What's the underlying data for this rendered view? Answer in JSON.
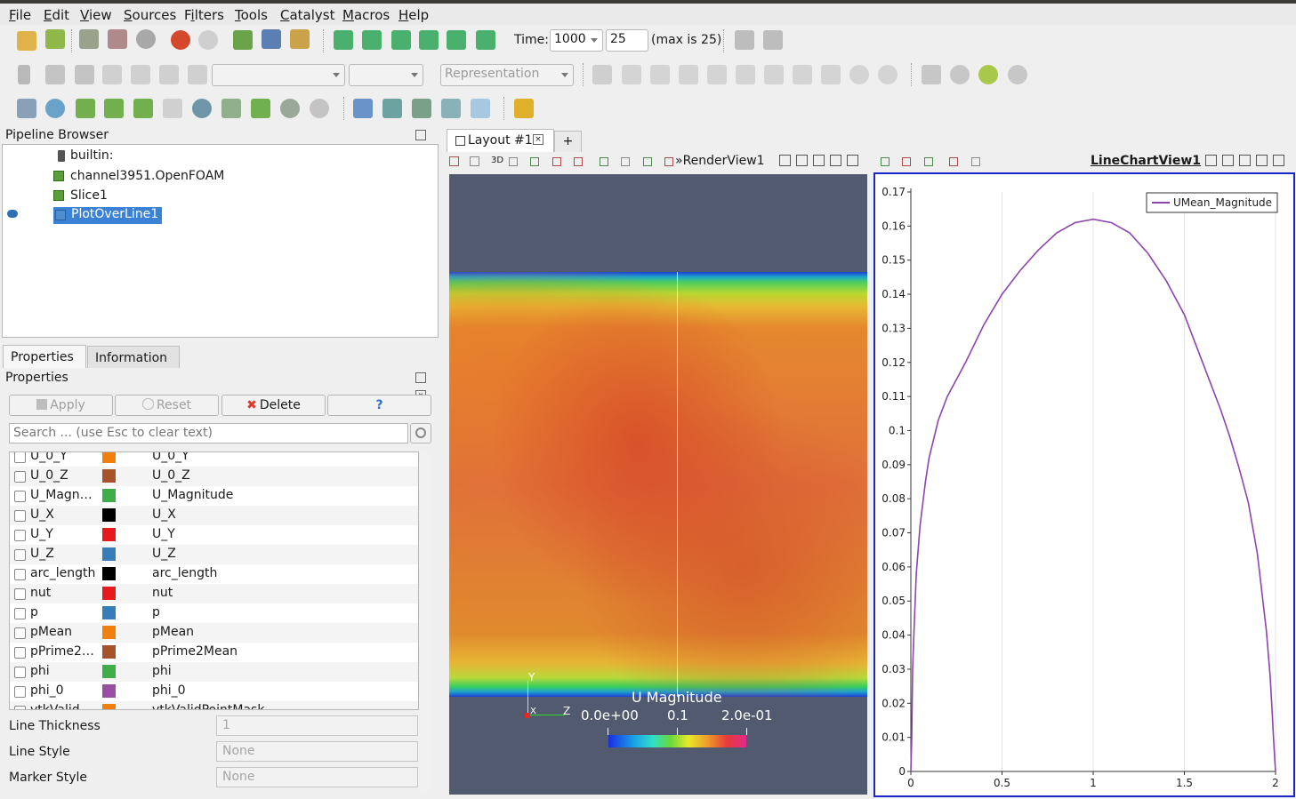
{
  "menu": [
    {
      "label": "File",
      "u": "F",
      "rest": "ile"
    },
    {
      "label": "Edit",
      "u": "E",
      "rest": "dit"
    },
    {
      "label": "View",
      "u": "V",
      "rest": "iew"
    },
    {
      "label": "Sources",
      "u": "S",
      "rest": "ources"
    },
    {
      "label": "Filters",
      "u": "i",
      "pre": "F",
      "rest": "lters"
    },
    {
      "label": "Tools",
      "u": "T",
      "rest": "ools"
    },
    {
      "label": "Catalyst",
      "u": "C",
      "rest": "atalyst"
    },
    {
      "label": "Macros",
      "u": "M",
      "rest": "acros"
    },
    {
      "label": "Help",
      "u": "H",
      "rest": "elp"
    }
  ],
  "time": {
    "label": "Time:",
    "value": "1000",
    "step": "25",
    "max_text": "(max is 25)"
  },
  "toolbar2": {
    "representation_placeholder": "Representation"
  },
  "pipeline": {
    "title": "Pipeline Browser",
    "items": [
      {
        "label": "builtin:"
      },
      {
        "label": "channel3951.OpenFOAM"
      },
      {
        "label": "Slice1"
      },
      {
        "label": "PlotOverLine1"
      }
    ]
  },
  "tabs": {
    "properties": "Properties",
    "information": "Information"
  },
  "properties": {
    "title": "Properties",
    "apply": "Apply",
    "reset": "Reset",
    "delete": "Delete",
    "help": "?",
    "search_placeholder": "Search ... (use Esc to clear text)",
    "arrays": [
      {
        "name": "U_0_Y",
        "label": "U_0_Y",
        "color": "#f07f0e"
      },
      {
        "name": "U_0_Z",
        "label": "U_0_Z",
        "color": "#a6522a"
      },
      {
        "name": "U_Magn…",
        "label": "U_Magnitude",
        "color": "#3fae49"
      },
      {
        "name": "U_X",
        "label": "U_X",
        "color": "#000000"
      },
      {
        "name": "U_Y",
        "label": "U_Y",
        "color": "#e41a1c"
      },
      {
        "name": "U_Z",
        "label": "U_Z",
        "color": "#377eb8"
      },
      {
        "name": "arc_length",
        "label": "arc_length",
        "color": "#000000"
      },
      {
        "name": "nut",
        "label": "nut",
        "color": "#e41a1c"
      },
      {
        "name": "p",
        "label": "p",
        "color": "#377eb8"
      },
      {
        "name": "pMean",
        "label": "pMean",
        "color": "#f07f0e"
      },
      {
        "name": "pPrime2…",
        "label": "pPrime2Mean",
        "color": "#a6522a"
      },
      {
        "name": "phi",
        "label": "phi",
        "color": "#3fae49"
      },
      {
        "name": "phi_0",
        "label": "phi_0",
        "color": "#984ea3"
      },
      {
        "name": "vtkValid…",
        "label": "vtkValidPointMask",
        "color": "#f07f0e"
      }
    ],
    "line_thickness_label": "Line Thickness",
    "line_thickness_value": "1",
    "line_style_label": "Line Style",
    "line_style_value": "None",
    "marker_style_label": "Marker Style",
    "marker_style_value": "None"
  },
  "layout": {
    "tab": "Layout #1",
    "plus": "+"
  },
  "render_view": {
    "title": "RenderView1",
    "three_d": "3D",
    "colorbar_title": "U Magnitude",
    "colorbar_labels": [
      "0.0e+00",
      "0.1",
      "2.0e-01"
    ],
    "axis_y": "Y",
    "axis_x": "X",
    "axis_z": "Z"
  },
  "chart_view": {
    "title": "LineChartView1"
  },
  "chart_data": {
    "type": "line",
    "xlim": [
      0,
      2
    ],
    "ylim": [
      0,
      0.17
    ],
    "xticks": [
      "0",
      "0.5",
      "1",
      "1.5",
      "2"
    ],
    "yticks": [
      "0",
      "0.01",
      "0.02",
      "0.03",
      "0.04",
      "0.05",
      "0.06",
      "0.07",
      "0.08",
      "0.09",
      "0.1",
      "0.11",
      "0.12",
      "0.13",
      "0.14",
      "0.15",
      "0.16",
      "0.17"
    ],
    "legend_position": "top-right",
    "grid": true,
    "series": [
      {
        "name": "UMean_Magnitude",
        "color": "#8e44ad",
        "x": [
          0,
          0.005,
          0.01,
          0.02,
          0.03,
          0.05,
          0.08,
          0.1,
          0.15,
          0.2,
          0.25,
          0.3,
          0.4,
          0.5,
          0.6,
          0.7,
          0.8,
          0.9,
          1.0,
          1.1,
          1.2,
          1.3,
          1.4,
          1.5,
          1.6,
          1.7,
          1.75,
          1.8,
          1.85,
          1.9,
          1.92,
          1.95,
          1.97,
          1.98,
          1.99,
          1.995,
          2.0
        ],
        "y": [
          0,
          0.01,
          0.03,
          0.045,
          0.058,
          0.072,
          0.085,
          0.092,
          0.103,
          0.11,
          0.115,
          0.12,
          0.131,
          0.14,
          0.147,
          0.153,
          0.158,
          0.161,
          0.162,
          0.161,
          0.158,
          0.152,
          0.144,
          0.134,
          0.12,
          0.106,
          0.098,
          0.089,
          0.079,
          0.064,
          0.055,
          0.041,
          0.028,
          0.019,
          0.009,
          0.004,
          0
        ]
      }
    ]
  }
}
